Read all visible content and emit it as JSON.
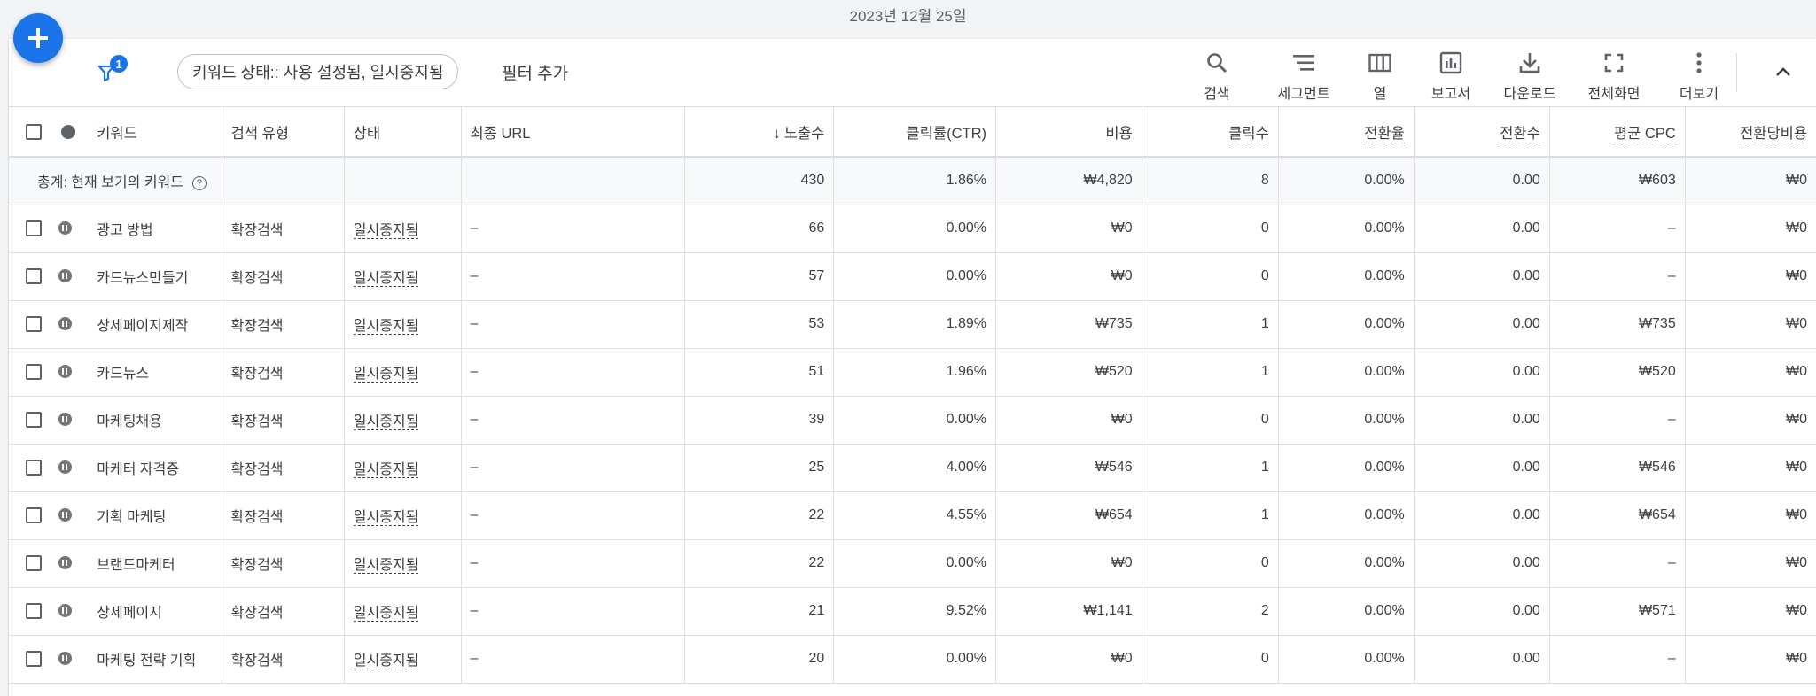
{
  "header": {
    "date": "2023년 12월 25일"
  },
  "fab": {
    "icon": "plus-icon"
  },
  "toolbar": {
    "filter_badge": "1",
    "filter_chip": "키워드 상태:: 사용 설정됨, 일시중지됨",
    "add_filter": "필터 추가",
    "tools": {
      "search": "검색",
      "segment": "세그먼트",
      "columns": "열",
      "reports": "보고서",
      "download": "다운로드",
      "fullscreen": "전체화면",
      "more": "더보기"
    }
  },
  "table": {
    "headers": {
      "keyword": "키워드",
      "match_type": "검색 유형",
      "status": "상태",
      "final_url": "최종 URL",
      "impressions": "노출수",
      "ctr": "클릭률(CTR)",
      "cost": "비용",
      "clicks": "클릭수",
      "conv_rate": "전환율",
      "conversions": "전환수",
      "avg_cpc": "평균 CPC",
      "cost_per_conv": "전환당비용"
    },
    "total": {
      "label": "총계: 현재 보기의 키워드",
      "impressions": "430",
      "ctr": "1.86%",
      "cost": "₩4,820",
      "clicks": "8",
      "conv_rate": "0.00%",
      "conversions": "0.00",
      "avg_cpc": "₩603",
      "cost_per_conv": "₩0"
    },
    "rows": [
      {
        "keyword": "광고 방법",
        "match_type": "확장검색",
        "status": "일시중지됨",
        "final_url": "–",
        "impressions": "66",
        "ctr": "0.00%",
        "cost": "₩0",
        "clicks": "0",
        "conv_rate": "0.00%",
        "conversions": "0.00",
        "avg_cpc": "–",
        "cost_per_conv": "₩0"
      },
      {
        "keyword": "카드뉴스만들기",
        "match_type": "확장검색",
        "status": "일시중지됨",
        "final_url": "–",
        "impressions": "57",
        "ctr": "0.00%",
        "cost": "₩0",
        "clicks": "0",
        "conv_rate": "0.00%",
        "conversions": "0.00",
        "avg_cpc": "–",
        "cost_per_conv": "₩0"
      },
      {
        "keyword": "상세페이지제작",
        "match_type": "확장검색",
        "status": "일시중지됨",
        "final_url": "–",
        "impressions": "53",
        "ctr": "1.89%",
        "cost": "₩735",
        "clicks": "1",
        "conv_rate": "0.00%",
        "conversions": "0.00",
        "avg_cpc": "₩735",
        "cost_per_conv": "₩0"
      },
      {
        "keyword": "카드뉴스",
        "match_type": "확장검색",
        "status": "일시중지됨",
        "final_url": "–",
        "impressions": "51",
        "ctr": "1.96%",
        "cost": "₩520",
        "clicks": "1",
        "conv_rate": "0.00%",
        "conversions": "0.00",
        "avg_cpc": "₩520",
        "cost_per_conv": "₩0"
      },
      {
        "keyword": "마케팅채용",
        "match_type": "확장검색",
        "status": "일시중지됨",
        "final_url": "–",
        "impressions": "39",
        "ctr": "0.00%",
        "cost": "₩0",
        "clicks": "0",
        "conv_rate": "0.00%",
        "conversions": "0.00",
        "avg_cpc": "–",
        "cost_per_conv": "₩0"
      },
      {
        "keyword": "마케터 자격증",
        "match_type": "확장검색",
        "status": "일시중지됨",
        "final_url": "–",
        "impressions": "25",
        "ctr": "4.00%",
        "cost": "₩546",
        "clicks": "1",
        "conv_rate": "0.00%",
        "conversions": "0.00",
        "avg_cpc": "₩546",
        "cost_per_conv": "₩0"
      },
      {
        "keyword": "기획 마케팅",
        "match_type": "확장검색",
        "status": "일시중지됨",
        "final_url": "–",
        "impressions": "22",
        "ctr": "4.55%",
        "cost": "₩654",
        "clicks": "1",
        "conv_rate": "0.00%",
        "conversions": "0.00",
        "avg_cpc": "₩654",
        "cost_per_conv": "₩0"
      },
      {
        "keyword": "브랜드마케터",
        "match_type": "확장검색",
        "status": "일시중지됨",
        "final_url": "–",
        "impressions": "22",
        "ctr": "0.00%",
        "cost": "₩0",
        "clicks": "0",
        "conv_rate": "0.00%",
        "conversions": "0.00",
        "avg_cpc": "–",
        "cost_per_conv": "₩0"
      },
      {
        "keyword": "상세페이지",
        "match_type": "확장검색",
        "status": "일시중지됨",
        "final_url": "–",
        "impressions": "21",
        "ctr": "9.52%",
        "cost": "₩1,141",
        "clicks": "2",
        "conv_rate": "0.00%",
        "conversions": "0.00",
        "avg_cpc": "₩571",
        "cost_per_conv": "₩0"
      },
      {
        "keyword": "마케팅 전략 기획",
        "match_type": "확장검색",
        "status": "일시중지됨",
        "final_url": "–",
        "impressions": "20",
        "ctr": "0.00%",
        "cost": "₩0",
        "clicks": "0",
        "conv_rate": "0.00%",
        "conversions": "0.00",
        "avg_cpc": "–",
        "cost_per_conv": "₩0"
      }
    ]
  },
  "colors": {
    "accent": "#1a73e8",
    "paused": "#757575"
  }
}
